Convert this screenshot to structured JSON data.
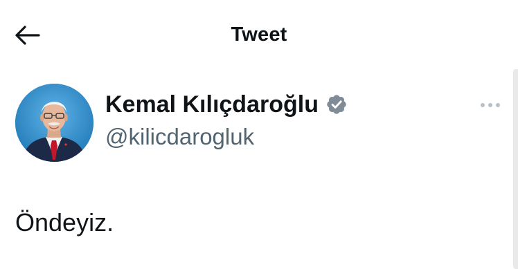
{
  "header": {
    "back_icon": "arrow-left-icon",
    "title": "Tweet"
  },
  "author": {
    "display_name": "Kemal Kılıçdaroğlu",
    "handle": "@kilicdarogluk",
    "verified_icon": "verified-badge-icon",
    "verified_color": "#7f8c97"
  },
  "tweet": {
    "text": "Öndeyiz."
  },
  "menu": {
    "more_icon": "more-options-icon"
  },
  "colors": {
    "text_primary": "#0f1419",
    "text_secondary": "#536471",
    "avatar_background": "#2f8fc9"
  }
}
